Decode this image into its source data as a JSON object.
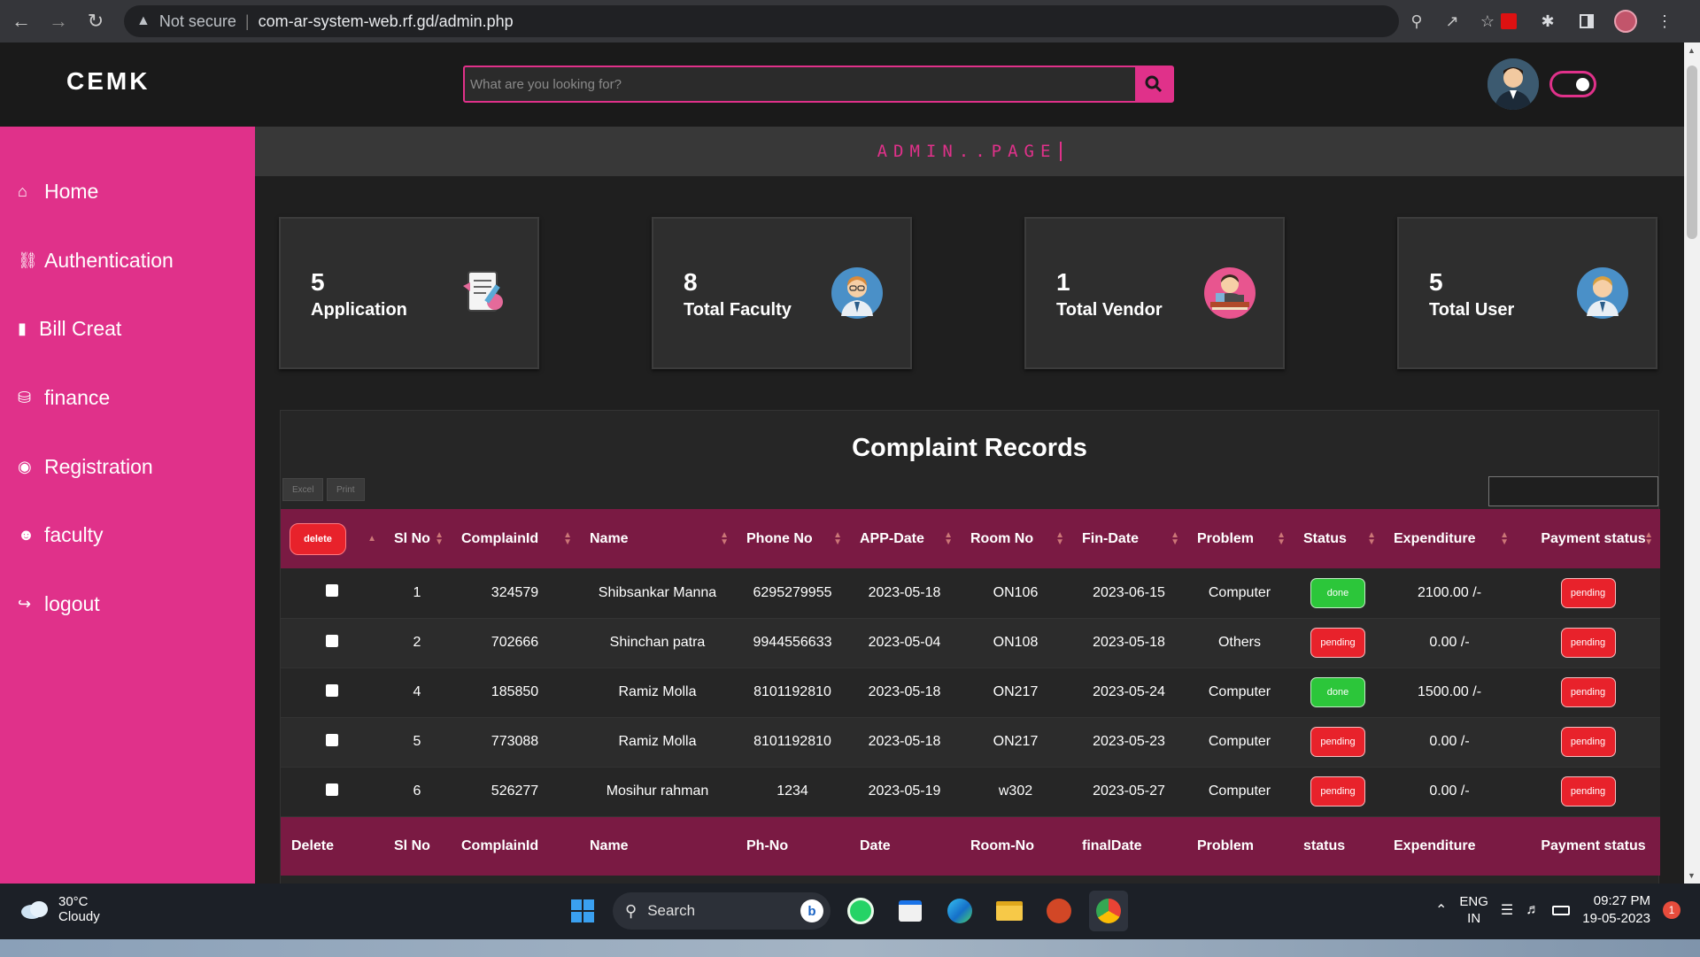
{
  "browser": {
    "security_label": "Not secure",
    "url": "com-ar-system-web.rf.gd/admin.php"
  },
  "header": {
    "brand": "CEMK",
    "search_placeholder": "What are you looking for?"
  },
  "sidebar": {
    "items": [
      {
        "label": "Home",
        "icon": "home-icon"
      },
      {
        "label": "Authentication",
        "icon": "car-icon"
      },
      {
        "label": "Bill Creat",
        "icon": "document-icon"
      },
      {
        "label": "finance",
        "icon": "coins-icon"
      },
      {
        "label": "Registration",
        "icon": "user-circle-icon"
      },
      {
        "label": "faculty",
        "icon": "users-icon"
      },
      {
        "label": "logout",
        "icon": "logout-icon"
      }
    ]
  },
  "page": {
    "banner": "ADMIN..PAGE"
  },
  "cards": [
    {
      "value": "5",
      "label": "Application",
      "icon": "application-form-icon"
    },
    {
      "value": "8",
      "label": "Total Faculty",
      "icon": "faculty-avatar-icon"
    },
    {
      "value": "1",
      "label": "Total Vendor",
      "icon": "vendor-avatar-icon"
    },
    {
      "value": "5",
      "label": "Total User",
      "icon": "user-avatar-icon"
    }
  ],
  "table": {
    "title": "Complaint Records",
    "tools": {
      "excel": "Excel",
      "print": "Print"
    },
    "delete_button": "delete",
    "headers": [
      "Sl No",
      "ComplainId",
      "Name",
      "Phone No",
      "APP-Date",
      "Room No",
      "Fin-Date",
      "Problem",
      "Status",
      "Expenditure",
      "Payment status"
    ],
    "rows": [
      {
        "sl": "1",
        "id": "324579",
        "name": "Shibsankar Manna",
        "phone": "6295279955",
        "app_date": "2023-05-18",
        "room": "ON106",
        "fin_date": "2023-06-15",
        "problem": "Computer",
        "status": "done",
        "expenditure": "2100.00 /-",
        "payment": "pending"
      },
      {
        "sl": "2",
        "id": "702666",
        "name": "Shinchan patra",
        "phone": "9944556633",
        "app_date": "2023-05-04",
        "room": "ON108",
        "fin_date": "2023-05-18",
        "problem": "Others",
        "status": "pending",
        "expenditure": "0.00 /-",
        "payment": "pending"
      },
      {
        "sl": "4",
        "id": "185850",
        "name": "Ramiz Molla",
        "phone": "8101192810",
        "app_date": "2023-05-18",
        "room": "ON217",
        "fin_date": "2023-05-24",
        "problem": "Computer",
        "status": "done",
        "expenditure": "1500.00 /-",
        "payment": "pending"
      },
      {
        "sl": "5",
        "id": "773088",
        "name": "Ramiz Molla",
        "phone": "8101192810",
        "app_date": "2023-05-18",
        "room": "ON217",
        "fin_date": "2023-05-23",
        "problem": "Computer",
        "status": "pending",
        "expenditure": "0.00 /-",
        "payment": "pending"
      },
      {
        "sl": "6",
        "id": "526277",
        "name": "Mosihur rahman",
        "phone": "1234",
        "app_date": "2023-05-19",
        "room": "w302",
        "fin_date": "2023-05-27",
        "problem": "Computer",
        "status": "pending",
        "expenditure": "0.00 /-",
        "payment": "pending"
      }
    ],
    "footer": [
      "Delete",
      "Sl No",
      "ComplainId",
      "Name",
      "Ph-No",
      "Date",
      "Room-No",
      "finalDate",
      "Problem",
      "status",
      "Expenditure",
      "Payment status"
    ]
  },
  "taskbar": {
    "weather_temp": "30°C",
    "weather_desc": "Cloudy",
    "search_label": "Search",
    "lang_top": "ENG",
    "lang_bottom": "IN",
    "time": "09:27 PM",
    "date": "19-05-2023",
    "notifications": "1"
  },
  "colors": {
    "accent": "#e0318a",
    "table_header": "#7a1a43",
    "done": "#2cc63a",
    "pending": "#e8222b"
  }
}
